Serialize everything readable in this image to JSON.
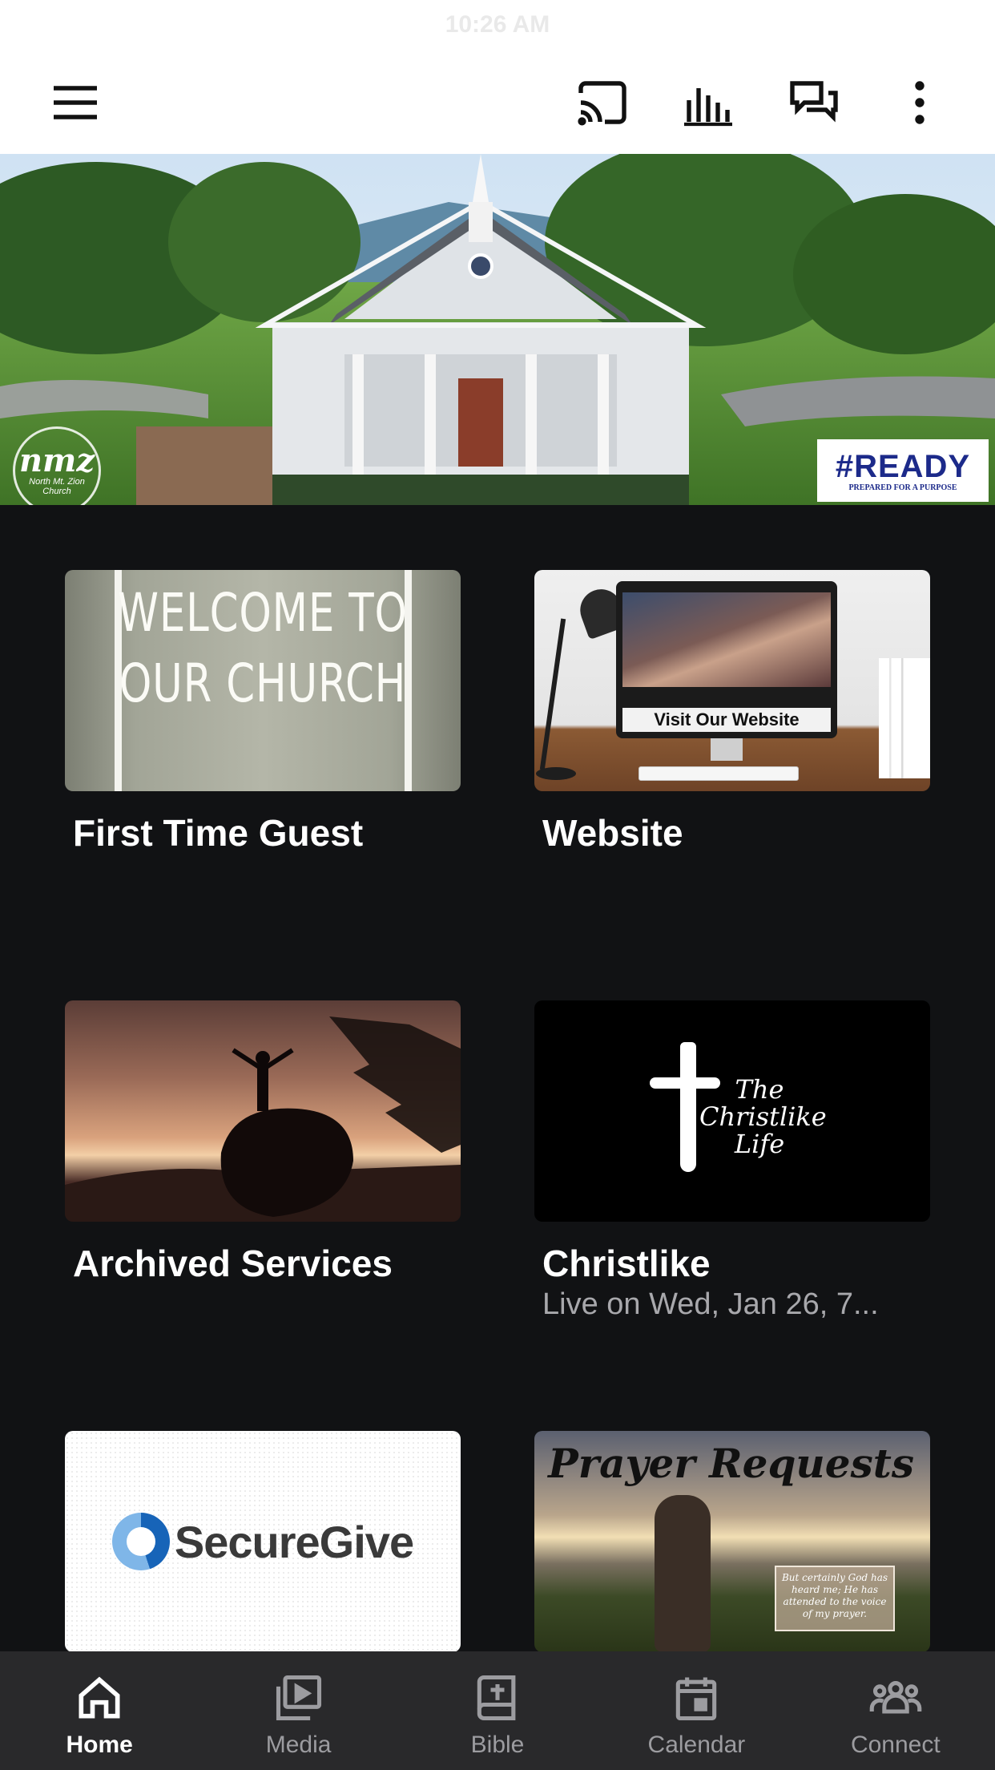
{
  "status_bar": {
    "time": "10:26 AM"
  },
  "top_bar": {
    "icons": [
      "hamburger-menu-icon",
      "cast-icon",
      "audio-bars-icon",
      "chat-icon",
      "more-vert-icon"
    ]
  },
  "hero": {
    "logo_mark": "nmz",
    "logo_sub": "North Mt. Zion Church",
    "badge_title": "#READY",
    "badge_tagline": "PREPARED FOR A PURPOSE"
  },
  "tiles": [
    {
      "title": "First Time Guest",
      "subtitle": "",
      "image_text": "WELCOME TO OUR CHURCH"
    },
    {
      "title": "Website",
      "subtitle": "",
      "image_text": "Visit Our Website"
    },
    {
      "title": "Archived Services",
      "subtitle": "",
      "image_text": ""
    },
    {
      "title": "Christlike",
      "subtitle": "Live on Wed, Jan 26, 7...",
      "image_text": "The Christlike Life"
    },
    {
      "title": "",
      "subtitle": "",
      "image_text": "SecureGive"
    },
    {
      "title": "",
      "subtitle": "",
      "image_text": "Prayer Requests",
      "image_verse": "But certainly God has heard me; He has attended to the voice of my prayer."
    }
  ],
  "bottom_nav": {
    "items": [
      {
        "label": "Home",
        "icon": "home-icon",
        "active": true
      },
      {
        "label": "Media",
        "icon": "media-icon",
        "active": false
      },
      {
        "label": "Bible",
        "icon": "bible-icon",
        "active": false
      },
      {
        "label": "Calendar",
        "icon": "calendar-icon",
        "active": false
      },
      {
        "label": "Connect",
        "icon": "connect-icon",
        "active": false
      }
    ]
  },
  "colors": {
    "background": "#111214",
    "nav_background": "#29292b",
    "nav_inactive": "#9c9ca0",
    "accent_text": "#ffffff"
  }
}
